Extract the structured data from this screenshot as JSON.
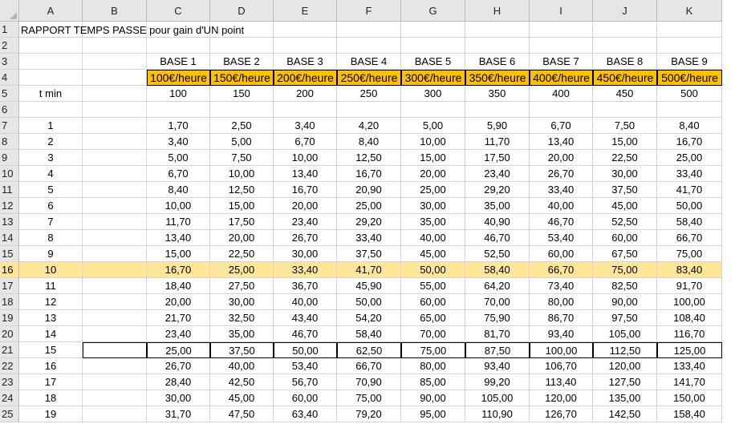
{
  "columns": [
    "A",
    "B",
    "C",
    "D",
    "E",
    "F",
    "G",
    "H",
    "I",
    "J",
    "K"
  ],
  "title": "RAPPORT TEMPS PASSE pour gain d'UN point",
  "bases": [
    "BASE 1",
    "BASE 2",
    "BASE 3",
    "BASE 4",
    "BASE 5",
    "BASE 6",
    "BASE 7",
    "BASE 8",
    "BASE 9"
  ],
  "rates": [
    "100€/heure",
    "150€/heure",
    "200€/heure",
    "250€/heure",
    "300€/heure",
    "350€/heure",
    "400€/heure",
    "450€/heure",
    "500€/heure"
  ],
  "header_label": "t min",
  "rate_values": [
    "100",
    "150",
    "200",
    "250",
    "300",
    "350",
    "400",
    "450",
    "500"
  ],
  "selected_row": 16,
  "boxed_row": 21,
  "data_rows": [
    {
      "row": "7",
      "t": "1",
      "v": [
        "1,70",
        "2,50",
        "3,40",
        "4,20",
        "5,00",
        "5,90",
        "6,70",
        "7,50",
        "8,40"
      ]
    },
    {
      "row": "8",
      "t": "2",
      "v": [
        "3,40",
        "5,00",
        "6,70",
        "8,40",
        "10,00",
        "11,70",
        "13,40",
        "15,00",
        "16,70"
      ]
    },
    {
      "row": "9",
      "t": "3",
      "v": [
        "5,00",
        "7,50",
        "10,00",
        "12,50",
        "15,00",
        "17,50",
        "20,00",
        "22,50",
        "25,00"
      ]
    },
    {
      "row": "10",
      "t": "4",
      "v": [
        "6,70",
        "10,00",
        "13,40",
        "16,70",
        "20,00",
        "23,40",
        "26,70",
        "30,00",
        "33,40"
      ]
    },
    {
      "row": "11",
      "t": "5",
      "v": [
        "8,40",
        "12,50",
        "16,70",
        "20,90",
        "25,00",
        "29,20",
        "33,40",
        "37,50",
        "41,70"
      ]
    },
    {
      "row": "12",
      "t": "6",
      "v": [
        "10,00",
        "15,00",
        "20,00",
        "25,00",
        "30,00",
        "35,00",
        "40,00",
        "45,00",
        "50,00"
      ]
    },
    {
      "row": "13",
      "t": "7",
      "v": [
        "11,70",
        "17,50",
        "23,40",
        "29,20",
        "35,00",
        "40,90",
        "46,70",
        "52,50",
        "58,40"
      ]
    },
    {
      "row": "14",
      "t": "8",
      "v": [
        "13,40",
        "20,00",
        "26,70",
        "33,40",
        "40,00",
        "46,70",
        "53,40",
        "60,00",
        "66,70"
      ]
    },
    {
      "row": "15",
      "t": "9",
      "v": [
        "15,00",
        "22,50",
        "30,00",
        "37,50",
        "45,00",
        "52,50",
        "60,00",
        "67,50",
        "75,00"
      ]
    },
    {
      "row": "16",
      "t": "10",
      "v": [
        "16,70",
        "25,00",
        "33,40",
        "41,70",
        "50,00",
        "58,40",
        "66,70",
        "75,00",
        "83,40"
      ]
    },
    {
      "row": "17",
      "t": "11",
      "v": [
        "18,40",
        "27,50",
        "36,70",
        "45,90",
        "55,00",
        "64,20",
        "73,40",
        "82,50",
        "91,70"
      ]
    },
    {
      "row": "18",
      "t": "12",
      "v": [
        "20,00",
        "30,00",
        "40,00",
        "50,00",
        "60,00",
        "70,00",
        "80,00",
        "90,00",
        "100,00"
      ]
    },
    {
      "row": "19",
      "t": "13",
      "v": [
        "21,70",
        "32,50",
        "43,40",
        "54,20",
        "65,00",
        "75,90",
        "86,70",
        "97,50",
        "108,40"
      ]
    },
    {
      "row": "20",
      "t": "14",
      "v": [
        "23,40",
        "35,00",
        "46,70",
        "58,40",
        "70,00",
        "81,70",
        "93,40",
        "105,00",
        "116,70"
      ]
    },
    {
      "row": "21",
      "t": "15",
      "v": [
        "25,00",
        "37,50",
        "50,00",
        "62,50",
        "75,00",
        "87,50",
        "100,00",
        "112,50",
        "125,00"
      ]
    },
    {
      "row": "22",
      "t": "16",
      "v": [
        "26,70",
        "40,00",
        "53,40",
        "66,70",
        "80,00",
        "93,40",
        "106,70",
        "120,00",
        "133,40"
      ]
    },
    {
      "row": "23",
      "t": "17",
      "v": [
        "28,40",
        "42,50",
        "56,70",
        "70,90",
        "85,00",
        "99,20",
        "113,40",
        "127,50",
        "141,70"
      ]
    },
    {
      "row": "24",
      "t": "18",
      "v": [
        "30,00",
        "45,00",
        "60,00",
        "75,00",
        "90,00",
        "105,00",
        "120,00",
        "135,00",
        "150,00"
      ]
    },
    {
      "row": "25",
      "t": "19",
      "v": [
        "31,70",
        "47,50",
        "63,40",
        "79,20",
        "95,00",
        "110,90",
        "126,70",
        "142,50",
        "158,40"
      ]
    }
  ]
}
